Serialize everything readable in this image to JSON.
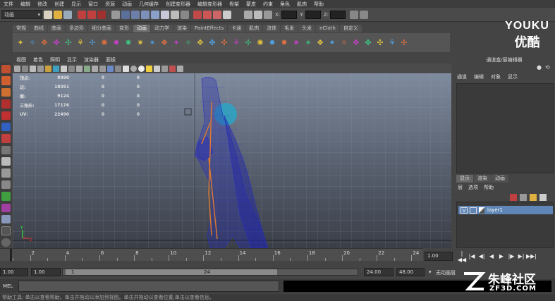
{
  "menubar": [
    "文件",
    "编辑",
    "修改",
    "创建",
    "显示",
    "窗口",
    "资源",
    "动画",
    "几何缓存",
    "创建变形器",
    "编辑变形器",
    "骨架",
    "蒙皮",
    "约束",
    "角色",
    "肌肉",
    "帮助"
  ],
  "status": {
    "mode": "动画",
    "x_label": "X:",
    "y_label": "Y:",
    "z_label": "Z:"
  },
  "shelf_tabs": [
    "常规",
    "曲线",
    "曲面",
    "多边形",
    "细分曲面",
    "变形",
    "动画",
    "动力学",
    "渲染",
    "PaintEffects",
    "卡通",
    "肌肉",
    "流体",
    "毛发",
    "头发",
    "nCloth",
    "自定义"
  ],
  "shelf_active_tab": "动画",
  "shelf_icon_count": 33,
  "watermark": {
    "youku_en": "YOUKU",
    "youku_cn": "优酷",
    "zf3d_cn": "朱峰社区",
    "zf3d_en": "ZF3D.COM"
  },
  "panel_menu": [
    "视图",
    "着色",
    "照明",
    "显示",
    "渲染器",
    "面板"
  ],
  "hud": [
    {
      "label": "顶点:",
      "value": "8990",
      "c1": "0",
      "c2": "0"
    },
    {
      "label": "边:",
      "value": "18051",
      "c1": "0",
      "c2": "0"
    },
    {
      "label": "面:",
      "value": "9124",
      "c1": "0",
      "c2": "0"
    },
    {
      "label": "三角形:",
      "value": "17176",
      "c1": "0",
      "c2": "0"
    },
    {
      "label": "UV:",
      "value": "22490",
      "c1": "0",
      "c2": "0"
    }
  ],
  "right_panel": {
    "title": "通道盒/层编辑器",
    "menu": [
      "通道",
      "编辑",
      "对象",
      "显示"
    ],
    "layer_tabs": [
      "显示",
      "渲染",
      "动画"
    ],
    "layer_active_tab": "显示",
    "layer_menu": [
      "层",
      "选项",
      "帮助"
    ],
    "layer": {
      "visible": "V",
      "name": "layer1"
    }
  },
  "timeline": {
    "ticks": [
      "2",
      "4",
      "6",
      "8",
      "10",
      "12",
      "14",
      "16",
      "18",
      "20",
      "22",
      "24"
    ],
    "current_frame": "1.00"
  },
  "playback_icons": [
    "|◀◀",
    "|◀",
    "◀|",
    "◀",
    "▶",
    "|▶",
    "▶|",
    "▶▶|"
  ],
  "range": {
    "start_outer": "1.00",
    "start_inner": "1.00",
    "slider_start": "1",
    "slider_end": "24",
    "end_inner": "24.00",
    "end_outer": "48.00",
    "char_set": "无动画层"
  },
  "cmd": {
    "label": "MEL"
  },
  "help_line": "帮助工具: 单击以查看帮助。单击并拖动以添加到视图。单击并拖动以查看位置,单击以查看信息。",
  "colors": {
    "accent": "#5f86b6",
    "viewport_top": "#7f8b9e",
    "viewport_bottom": "#3a3e47",
    "mesh": "#2a2fbf"
  }
}
